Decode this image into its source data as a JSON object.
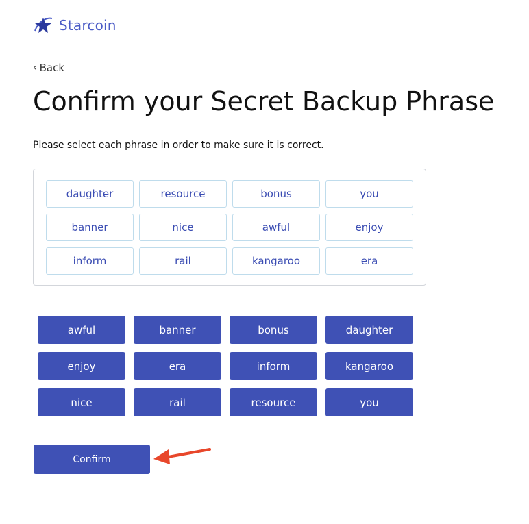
{
  "brand": {
    "name": "Starcoin",
    "logo_icon": "star-swoosh-icon",
    "color": "#4a5bc6"
  },
  "nav": {
    "back_label": "Back",
    "back_icon": "chevron-left-icon"
  },
  "page": {
    "title": "Confirm your Secret Backup Phrase",
    "instructions": "Please select each phrase in order to make sure it is correct."
  },
  "selected_words": [
    "daughter",
    "resource",
    "bonus",
    "you",
    "banner",
    "nice",
    "awful",
    "enjoy",
    "inform",
    "rail",
    "kangaroo",
    "era"
  ],
  "word_pool": [
    "awful",
    "banner",
    "bonus",
    "daughter",
    "enjoy",
    "era",
    "inform",
    "kangaroo",
    "nice",
    "rail",
    "resource",
    "you"
  ],
  "actions": {
    "confirm_label": "Confirm"
  },
  "annotation": {
    "arrow_icon": "red-arrow-icon",
    "color": "#e8472b"
  },
  "colors": {
    "primary": "#3f51b5",
    "chip_border": "#bfdcec",
    "chip_text": "#3b4db3"
  }
}
